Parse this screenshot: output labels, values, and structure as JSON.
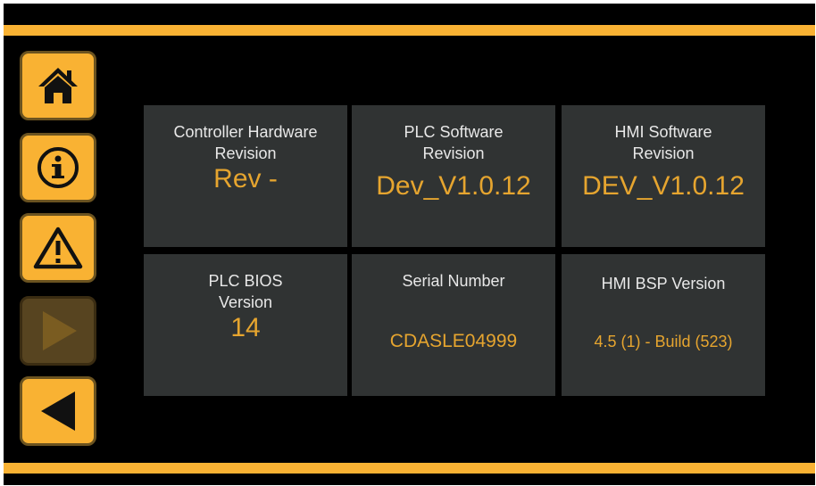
{
  "theme": {
    "accent": "#f9b233",
    "value_color": "#e6a52f",
    "tile_bg": "#303333",
    "background": "#000000"
  },
  "nav": [
    {
      "icon": "home-icon",
      "enabled": true
    },
    {
      "icon": "info-icon",
      "enabled": true
    },
    {
      "icon": "warning-icon",
      "enabled": true
    },
    {
      "icon": "play-icon",
      "enabled": false
    },
    {
      "icon": "back-arrow-icon",
      "enabled": true
    }
  ],
  "tiles": {
    "controller_hw": {
      "label": "Controller Hardware\nRevision",
      "value": "Rev -"
    },
    "plc_sw": {
      "label": "PLC Software\nRevision",
      "value": "Dev_V1.0.12"
    },
    "hmi_sw": {
      "label": "HMI Software\nRevision",
      "value": "DEV_V1.0.12"
    },
    "plc_bios": {
      "label": "PLC BIOS\nVersion",
      "value": "14"
    },
    "serial": {
      "label": "Serial Number",
      "value": "CDASLE04999"
    },
    "hmi_bsp": {
      "label": "HMI BSP Version",
      "value": "4.5 (1) - Build (523)"
    }
  }
}
